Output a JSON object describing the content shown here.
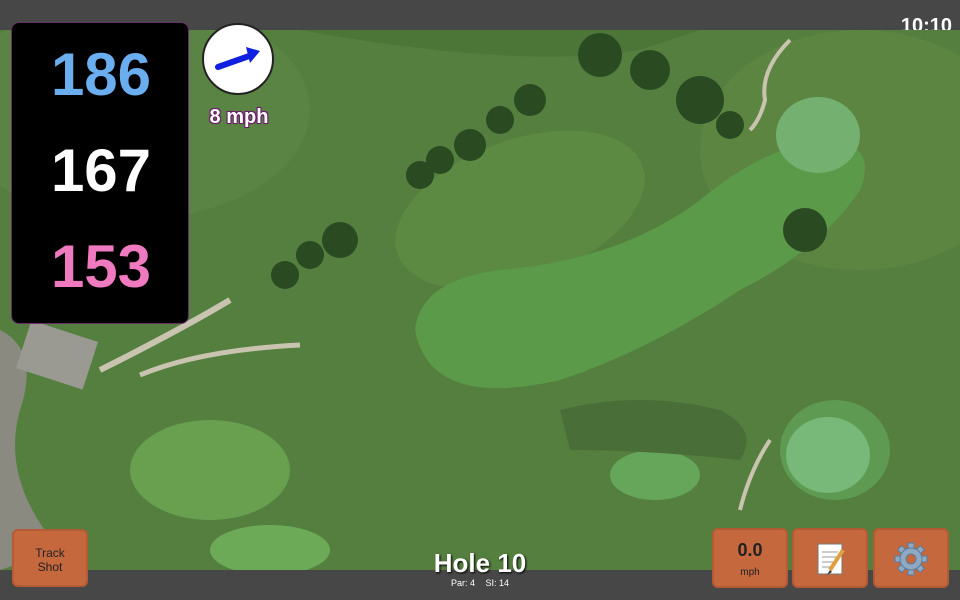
{
  "status_bar": {
    "time": "10:10"
  },
  "distances": {
    "back": "186",
    "center": "167",
    "front": "153"
  },
  "wind": {
    "speed_label": "8 mph",
    "direction_icon": "arrow-icon"
  },
  "hole": {
    "title": "Hole 10",
    "par": "Par: 4",
    "stroke_index": "SI: 14"
  },
  "buttons": {
    "track_shot": [
      "Track",
      "Shot"
    ],
    "wind_value": "0.0",
    "wind_unit": "mph",
    "notes_icon": "notepad-icon",
    "settings_icon": "gear-icon"
  },
  "colors": {
    "back": "#6aaef0",
    "center": "#ffffff",
    "front": "#f07ac0",
    "button": "#c5683e",
    "bar": "#474747"
  }
}
